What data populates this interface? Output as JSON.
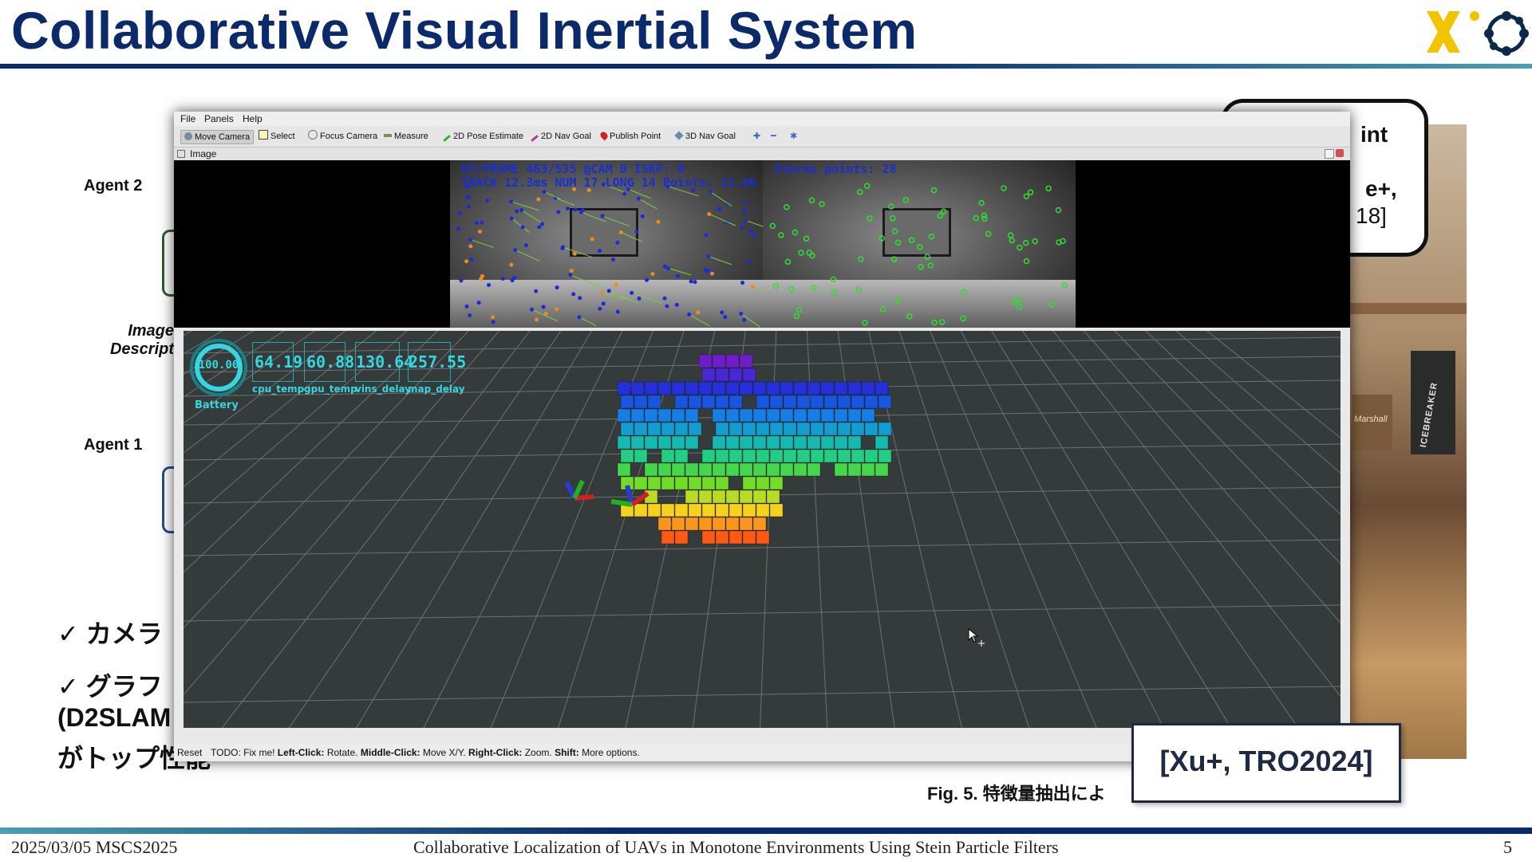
{
  "slide": {
    "title": "Collaborative Visual Inertial System",
    "agent2_label": "Agent 2",
    "agent1_label": "Agent 1",
    "image_desc_line1": "Image",
    "image_desc_line2": "Descript",
    "bullet1": "✓ カメラ",
    "bullet2_line1": "✓ グラフ",
    "bullet2_line2": "(D2SLAM",
    "bullet2_line3": "がトップ性能",
    "callout_line1": "int",
    "callout_line2": "e+,",
    "callout_line3": "18]",
    "reference": "[Xu+, TRO2024]",
    "fig_caption": "Fig. 5. 特徴量抽出によ",
    "photo_book_text": "ICEBREAKER",
    "photo_amp_text": "Marshall",
    "footer_left": "2025/03/05 MSCS2025",
    "footer_center": "Collaborative Localization of UAVs in Monotone Environments Using Stein Particle Filters",
    "footer_page": "5"
  },
  "rviz": {
    "menu": [
      "File",
      "Panels",
      "Help"
    ],
    "tools": [
      {
        "label": "Move Camera",
        "icon": "move-camera-icon"
      },
      {
        "label": "Select",
        "icon": "select-icon"
      },
      {
        "label": "Focus Camera",
        "icon": "focus-camera-icon"
      },
      {
        "label": "Measure",
        "icon": "measure-icon"
      },
      {
        "label": "2D Pose Estimate",
        "icon": "pose-estimate-icon"
      },
      {
        "label": "2D Nav Goal",
        "icon": "nav-goal-icon"
      },
      {
        "label": "Publish Point",
        "icon": "publish-point-icon"
      },
      {
        "label": "3D Nav Goal",
        "icon": "3d-nav-goal-icon"
      }
    ],
    "image_panel_title": "Image",
    "cam_left_line1": "KF/FRAME 463/535 @CAM 0 ISKF: 0",
    "cam_left_line2": "TRACK 12.3ms NUM 17 LONG 14 Points: 11.66",
    "cam_right_line1": "Stereo points: 28",
    "hud": {
      "battery_value": "100.00",
      "battery_label": "Battery",
      "battery_level": 1.0,
      "metrics": [
        {
          "value": "64.19",
          "label": "cpu_temp"
        },
        {
          "value": "60.88",
          "label": "gpu_temp"
        },
        {
          "value": "130.64",
          "label": "vins_delay"
        },
        {
          "value": "257.55",
          "label": "map_delay"
        }
      ]
    },
    "status": {
      "reset": "Reset",
      "todo": "TODO: Fix me!",
      "left_click": "Left-Click:",
      "left_click_action": "Rotate.",
      "middle_click": "Middle-Click:",
      "middle_click_action": "Move X/Y.",
      "right_click": "Right-Click:",
      "right_click_action": "Zoom.",
      "shift": "Shift:",
      "shift_action": "More options."
    },
    "colors": {
      "hud": "#35d6e0",
      "grid_bg": "#353a3b",
      "cam_text": "#1a2fd0",
      "title": "#0b2a6b"
    }
  }
}
